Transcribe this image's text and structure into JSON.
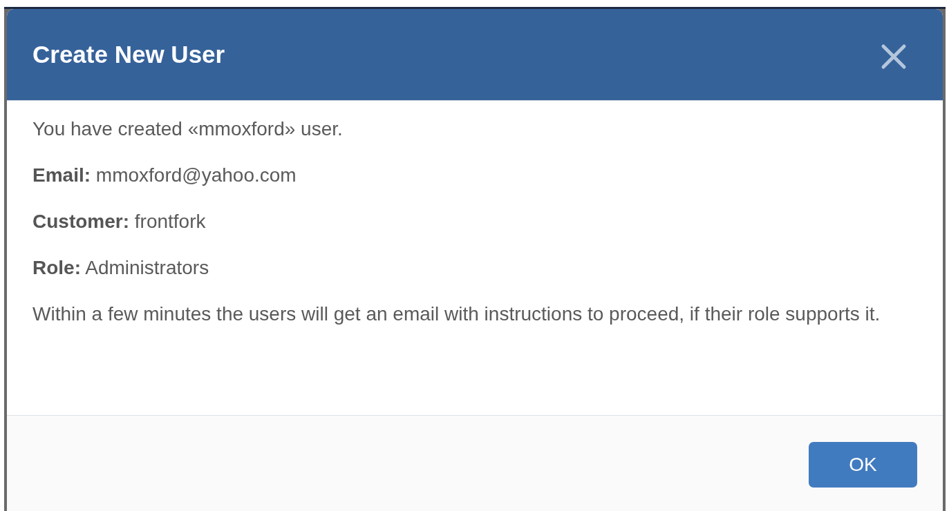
{
  "dialog": {
    "title": "Create New User",
    "message": "You have created «mmoxford» user.",
    "details": [
      {
        "label": "Email:",
        "value": "mmoxford@yahoo.com"
      },
      {
        "label": "Customer:",
        "value": "frontfork"
      },
      {
        "label": "Role:",
        "value": "Administrators"
      }
    ],
    "note": "Within a few minutes the users will get an email with instructions to proceed, if their role supports it.",
    "buttons": [
      "OK"
    ]
  }
}
